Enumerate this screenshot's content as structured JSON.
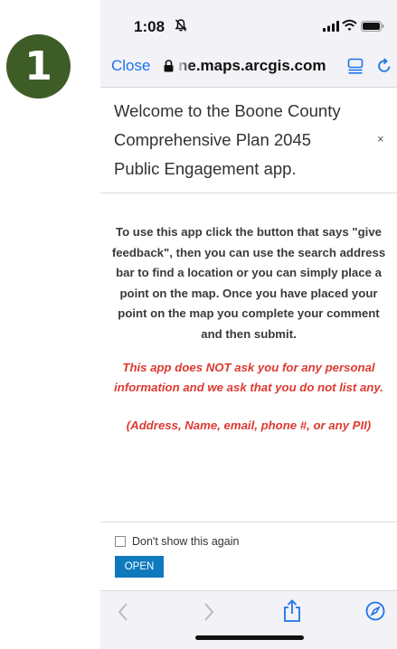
{
  "step_badge": {
    "number": "1"
  },
  "status_bar": {
    "time": "1:08",
    "icons": [
      "bell-off-icon",
      "signal-icon",
      "wifi-icon",
      "battery-icon"
    ]
  },
  "browser": {
    "close_label": "Close",
    "url": "ne.maps.arcgis.com",
    "icons": [
      "lock-icon",
      "reader-icon",
      "reload-icon"
    ]
  },
  "dialog": {
    "title": "Welcome to the Boone County Comprehensive Plan 2045 Public Engagement app.",
    "close_symbol": "×",
    "body_text": "To use this app click the button that says \"give feedback\", then you can use the search address bar to find a location or you can simply place a point on the map. Once you have placed your point on the map you complete your comment and then submit.",
    "warning_text": "This app does NOT ask you for any personal information and we ask that you do not list any.",
    "pii_text": "(Address, Name, email, phone #, or any PII)",
    "dont_show_label": "Don't show this again",
    "dont_show_checked": false,
    "open_label": "OPEN"
  },
  "toolbar": {
    "icons": [
      "back-icon",
      "forward-icon",
      "share-icon",
      "compass-icon"
    ]
  },
  "colors": {
    "badge": "#3e5c26",
    "link_blue": "#1c74e9",
    "warning_red": "#dd3a30",
    "button_blue": "#0f79be",
    "chrome_bg": "#f2f2f7"
  }
}
